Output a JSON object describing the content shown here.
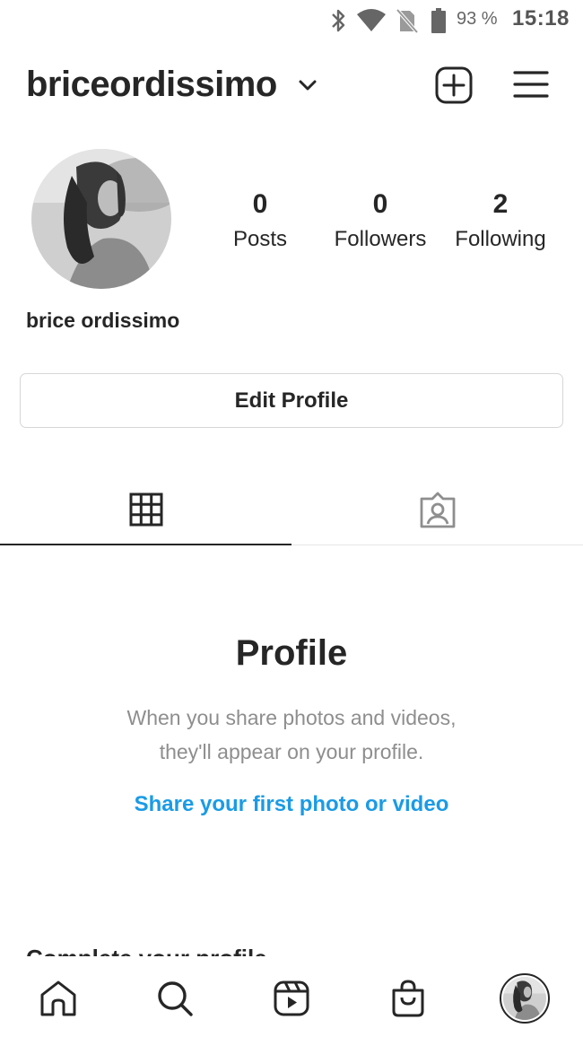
{
  "status_bar": {
    "battery_percent": "93 %",
    "time": "15:18",
    "icons": [
      "bluetooth-icon",
      "wifi-icon",
      "no-sim-icon",
      "battery-icon"
    ]
  },
  "header": {
    "username": "briceordissimo",
    "icons": [
      "chevron-down-icon",
      "add-post-icon",
      "menu-icon"
    ]
  },
  "profile": {
    "display_name": "brice ordissimo",
    "stats": [
      {
        "value": "0",
        "label": "Posts"
      },
      {
        "value": "0",
        "label": "Followers"
      },
      {
        "value": "2",
        "label": "Following"
      }
    ],
    "edit_button_label": "Edit Profile"
  },
  "tabs": [
    {
      "name": "grid",
      "icon": "grid-icon",
      "active": true
    },
    {
      "name": "tagged",
      "icon": "tagged-icon",
      "active": false
    }
  ],
  "empty_state": {
    "title": "Profile",
    "line1": "When you share photos and videos,",
    "line2": "they'll appear on your profile.",
    "link": "Share your first photo or video"
  },
  "complete_profile": {
    "title": "Complete your profile"
  },
  "bottom_nav": {
    "items": [
      "home-icon",
      "search-icon",
      "reels-icon",
      "shop-icon",
      "profile-avatar"
    ]
  },
  "colors": {
    "text": "#262626",
    "secondary": "#8e8e8e",
    "link": "#1a9be6",
    "border": "#d6d6d6"
  }
}
